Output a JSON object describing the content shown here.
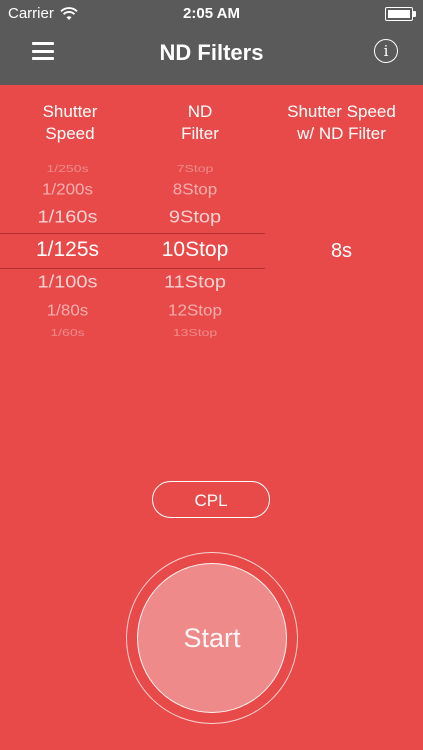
{
  "status_bar": {
    "carrier": "Carrier",
    "time": "2:05 AM"
  },
  "nav": {
    "title": "ND Filters"
  },
  "columns": {
    "shutter_speed": [
      "Shutter",
      "Speed"
    ],
    "nd_filter": [
      "ND",
      "Filter"
    ],
    "result": [
      "Shutter Speed",
      "w/ ND Filter"
    ]
  },
  "shutter_picker": [
    "1/250s",
    "1/200s",
    "1/160s",
    "1/125s",
    "1/100s",
    "1/80s",
    "1/60s"
  ],
  "nd_picker": [
    "7Stop",
    "8Stop",
    "9Stop",
    "10Stop",
    "11Stop",
    "12Stop",
    "13Stop"
  ],
  "selected": {
    "shutter": "1/125s",
    "nd": "10Stop"
  },
  "result_value": "8s",
  "buttons": {
    "cpl": "CPL",
    "start": "Start"
  },
  "colors": {
    "background": "#e84a4a",
    "nav_bar": "#5a5a5a"
  }
}
